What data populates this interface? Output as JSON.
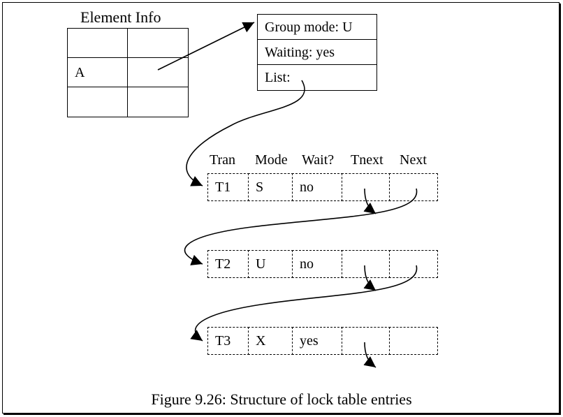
{
  "title": "Element Info",
  "element_grid": {
    "cell_mid_left": "A"
  },
  "header_box": {
    "group_mode": "Group mode: U",
    "waiting": "Waiting: yes",
    "list": "List:"
  },
  "columns": {
    "tran": "Tran",
    "mode": "Mode",
    "wait": "Wait?",
    "tnext": "Tnext",
    "next": "Next"
  },
  "rows": [
    {
      "tran": "T1",
      "mode": "S",
      "wait": "no"
    },
    {
      "tran": "T2",
      "mode": "U",
      "wait": "no"
    },
    {
      "tran": "T3",
      "mode": "X",
      "wait": "yes"
    }
  ],
  "caption": "Figure 9.26:  Structure of lock table  entries"
}
